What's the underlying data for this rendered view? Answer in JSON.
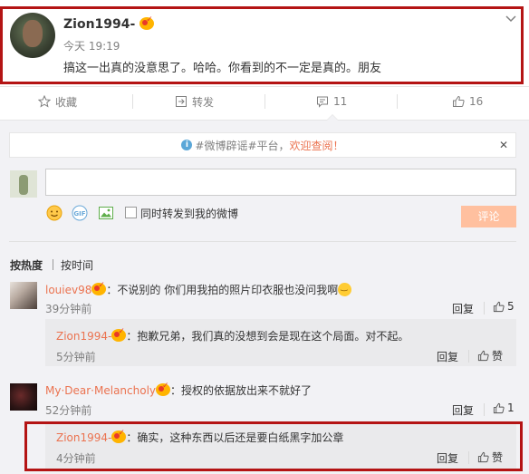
{
  "post": {
    "username": "Zion1994-",
    "time": "今天 19:19",
    "text": "搞这一出真的没意思了。哈哈。你看到的不一定是真的。朋友"
  },
  "actions": {
    "favorite": "收藏",
    "repost": "转发",
    "comments": "11",
    "likes": "16"
  },
  "notice": {
    "topic": "#微博辟谣#平台，",
    "link": "欢迎查阅！"
  },
  "composer": {
    "input_value": "",
    "repost_label": "同时转发到我的微博",
    "submit_label": "评论"
  },
  "sort": {
    "hot": "按热度",
    "time": "按时间"
  },
  "comments": [
    {
      "user": "louiev98",
      "text": "：不说别的 你们用我拍的照片印衣服也没问我啊",
      "time": "39分钟前",
      "reply": "回复",
      "likes": "5",
      "reply_item": {
        "user": "Zion1994-",
        "text": "：抱歉兄弟，我们真的没想到会是现在这个局面。对不起。",
        "time": "5分钟前",
        "reply": "回复",
        "like_label": "赞"
      }
    },
    {
      "user": "My·Dear·Melancholy",
      "text": "：授权的依据放出来不就好了",
      "time": "52分钟前",
      "reply": "回复",
      "likes": "1",
      "reply_item": {
        "user": "Zion1994-",
        "text": "：确实，这种东西以后还是要白纸黑字加公章",
        "time": "4分钟前",
        "reply": "回复",
        "like_label": "赞"
      }
    }
  ],
  "colors": {
    "highlight_border": "#b41414",
    "username_orange": "#eb7350",
    "submit_disabled": "#ffc09f",
    "panel_bg": "#f2f2f5"
  }
}
